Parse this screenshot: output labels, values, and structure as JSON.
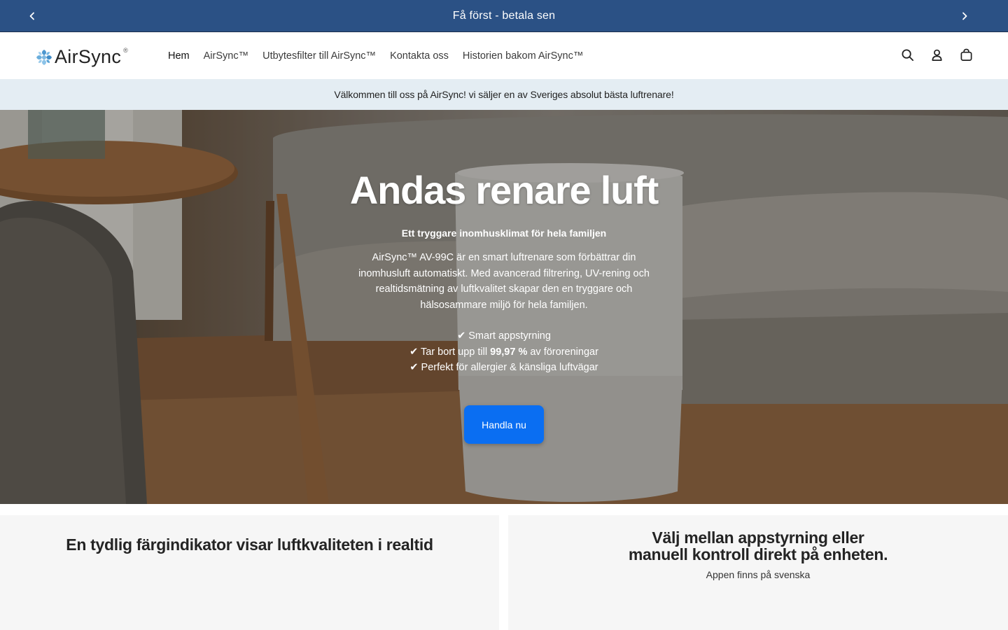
{
  "announcement": {
    "text": "Få först - betala sen",
    "background": "#2b5185"
  },
  "brand": {
    "name": "AirSync",
    "registered_mark": "®"
  },
  "nav": {
    "items": [
      {
        "label": "Hem"
      },
      {
        "label": "AirSync™"
      },
      {
        "label": "Utbytesfilter till AirSync™"
      },
      {
        "label": "Kontakta oss"
      },
      {
        "label": "Historien bakom AirSync™"
      }
    ]
  },
  "header_icons": [
    "search-icon",
    "account-icon",
    "cart-icon"
  ],
  "welcome": {
    "text": "Välkommen till oss på AirSync! vi säljer en av Sveriges absolut bästa luftrenare!"
  },
  "hero": {
    "title": "Andas renare luft",
    "subtitle": "Ett tryggare inomhusklimat för hela familjen",
    "description": "AirSync™ AV-99C är en smart luftrenare som förbättrar din inomhusluft automatiskt. Med avancerad filtrering, UV-rening och realtidsmätning av luftkvalitet skapar den en tryggare och hälsosammare miljö för hela familjen.",
    "bullet_1": "✔ Smart appstyrning",
    "bullet_2_prefix": "✔ Tar bort upp till ",
    "bullet_2_bold": "99,97 %",
    "bullet_2_suffix": " av föroreningar",
    "bullet_3": "✔ Perfekt för allergier & känsliga luftvägar",
    "cta": "Handla nu",
    "cta_color": "#0a6ef2"
  },
  "features": {
    "left_title": "En tydlig färgindikator visar luftkvaliteten i realtid",
    "right_title_line1": "Välj mellan appstyrning eller",
    "right_title_line2": "manuell kontroll direkt på enheten.",
    "right_subtitle": "Appen finns på svenska"
  }
}
